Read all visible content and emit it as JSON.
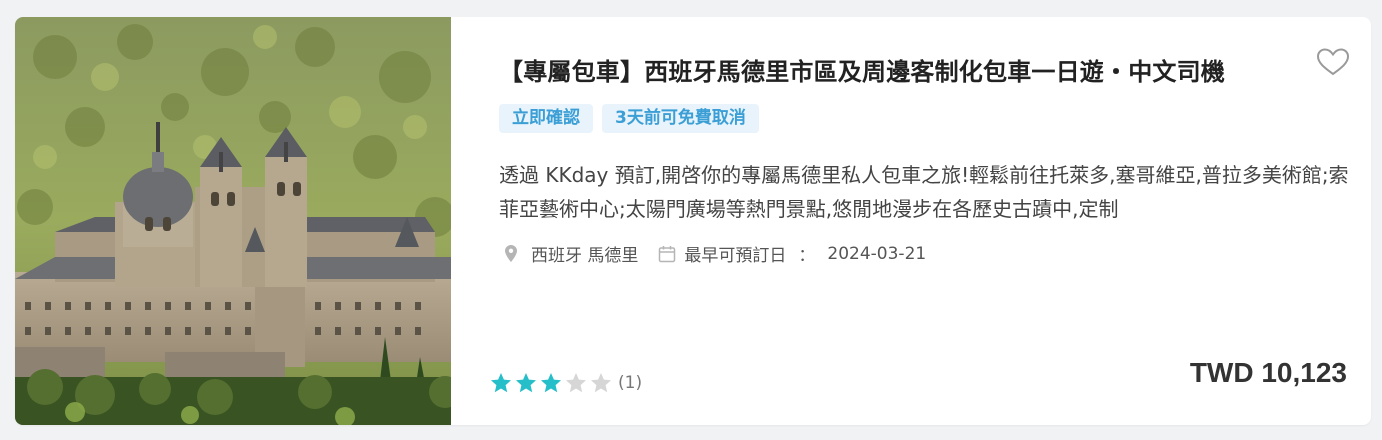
{
  "product": {
    "title": "【專屬包車】西班牙馬德里市區及周邊客制化包車一日遊・中文司機",
    "image_alt": "El Escorial monastery in forested hills",
    "tags": [
      "立即確認",
      "3天前可免費取消"
    ],
    "description": "透過 KKday 預訂,開啓你的專屬馬德里私人包車之旅!輕鬆前往托萊多,塞哥維亞,普拉多美術館;索菲亞藝術中心;太陽門廣場等熱門景點,悠閒地漫步在各歷史古蹟中,定制",
    "location": "西班牙 馬德里",
    "earliest_label": "最早可預訂日",
    "separator": "：",
    "earliest_date": "2024-03-21",
    "rating": 3,
    "rating_max": 5,
    "review_count": "(1)",
    "price": "TWD 10,123"
  },
  "icons": {
    "favorite": "heart-outline-icon",
    "location": "map-pin-icon",
    "calendar": "calendar-icon",
    "star": "star-icon"
  },
  "colors": {
    "star_filled": "#26bec9",
    "star_empty": "#d6d6d6",
    "tag_bg": "#e8f3fb",
    "tag_text": "#3b9fd6",
    "icon_gray": "#b5b5b5",
    "price": "#333333"
  }
}
